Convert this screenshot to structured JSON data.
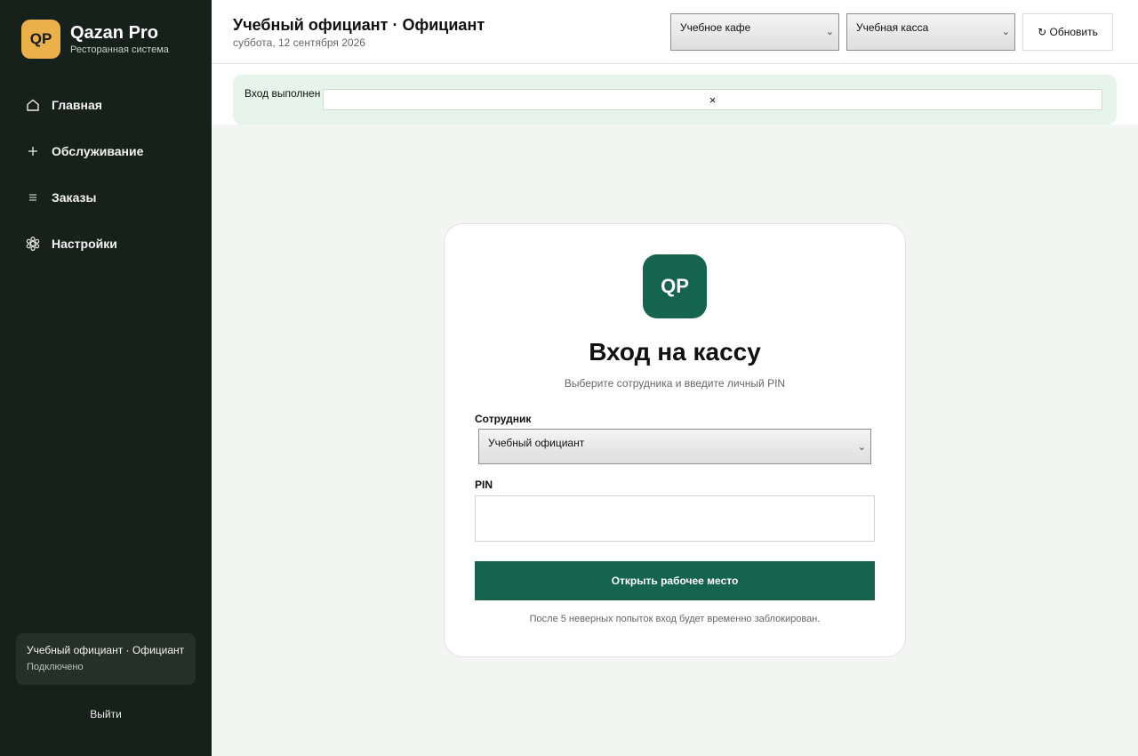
{
  "brand": {
    "logo": "QP",
    "name": "Qazan Pro",
    "subtitle": "Ресторанная система"
  },
  "nav": [
    {
      "label": "Главная",
      "icon": "home-icon"
    },
    {
      "label": "Обслуживание",
      "icon": "plus-icon"
    },
    {
      "label": "Заказы",
      "icon": "list-icon"
    },
    {
      "label": "Настройки",
      "icon": "gear-icon"
    }
  ],
  "user": {
    "name": "Учебный официант · Официант",
    "status": "Подключено"
  },
  "logout_label": "Выйти",
  "header": {
    "title": "Учебный официант · Официант",
    "date": "суббота, 12 сентября 2026",
    "cafe_select": "Учебное кафе",
    "cash_select": "Учебная касса",
    "refresh_label": "↻ Обновить"
  },
  "notice": {
    "text": "Вход выполнен",
    "close": "×"
  },
  "login": {
    "logo": "QP",
    "title": "Вход на кассу",
    "subtitle": "Выберите сотрудника и введите личный PIN",
    "employee_label": "Сотрудник",
    "employee_value": "Учебный официант",
    "pin_label": "PIN",
    "pin_value": "",
    "submit_label": "Открыть рабочее место",
    "note": "После 5 неверных попыток вход будет временно заблокирован."
  },
  "colors": {
    "sidebar": "#17211c",
    "accent": "#14644e",
    "brand": "#eab04a",
    "notice": "#e6f4ec"
  }
}
